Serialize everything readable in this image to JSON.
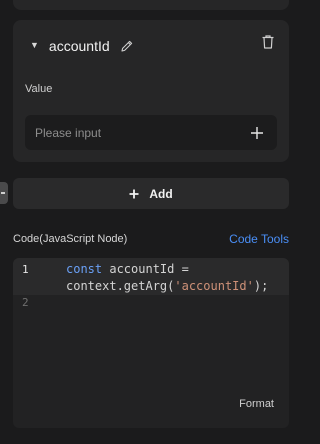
{
  "parameter": {
    "name": "accountId",
    "value_label": "Value",
    "value_placeholder": "Please input"
  },
  "add_button": {
    "label": "Add"
  },
  "code_section": {
    "label": "Code(JavaScript Node)",
    "tools_label": "Code Tools",
    "format_label": "Format",
    "lines": [
      {
        "number": "1",
        "keyword": "const",
        "line1_rest": " accountId =",
        "line2_prefix": "context.getArg(",
        "string": "'accountId'",
        "line2_suffix": ");"
      },
      {
        "number": "2"
      }
    ]
  },
  "colors": {
    "accent": "#4a8ff7",
    "background": "#1b1b1c",
    "card": "#262627"
  },
  "icons": [
    "caret-down-icon",
    "edit-icon",
    "trash-icon",
    "plus-icon",
    "add-plus-icon"
  ]
}
